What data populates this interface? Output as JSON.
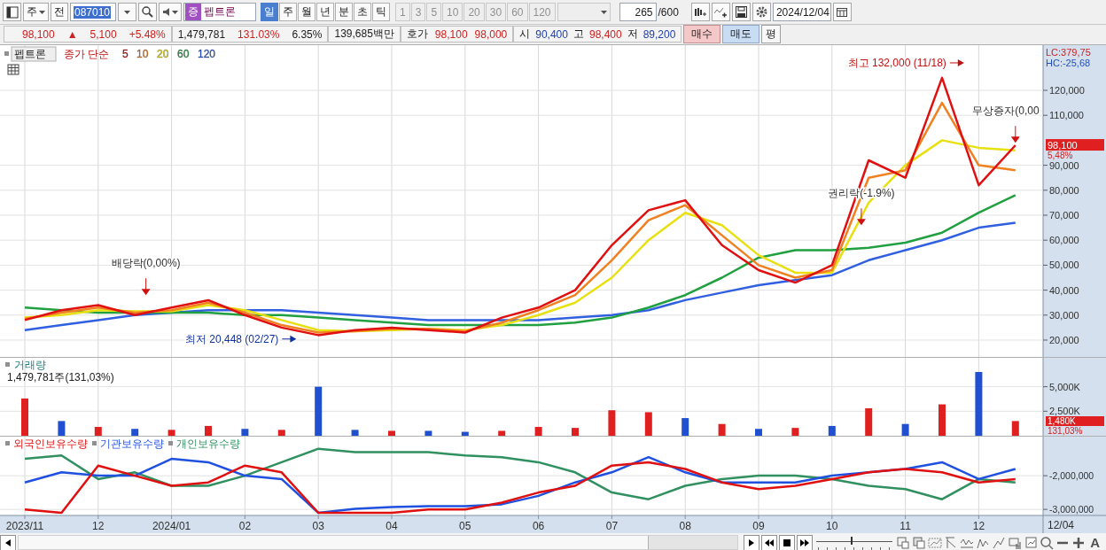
{
  "toolbar": {
    "market": "주",
    "prev": "전",
    "code": "087010",
    "badge": "증",
    "name": "펩트론",
    "periods": [
      {
        "label": "일",
        "selected": true
      },
      {
        "label": "주",
        "selected": false
      },
      {
        "label": "월",
        "selected": false
      },
      {
        "label": "년",
        "selected": false
      },
      {
        "label": "분",
        "selected": false
      },
      {
        "label": "초",
        "selected": false
      },
      {
        "label": "틱",
        "selected": false
      }
    ],
    "intervals": [
      "1",
      "3",
      "5",
      "10",
      "20",
      "30",
      "60",
      "120"
    ],
    "count": "265",
    "count_max": "/600",
    "date": "2024/12/04"
  },
  "quote": {
    "price": "98,100",
    "direction": "▲",
    "change": "5,100",
    "change_pct": "+5.48%",
    "volume": "1,479,781",
    "volume_ratio": "131.03%",
    "turnover": "6.35%",
    "amount": "139,685백만",
    "quote_label": "호가",
    "ask": "98,100",
    "bid": "98,000",
    "open_label": "시",
    "open": "90,400",
    "high_label": "고",
    "high": "98,400",
    "low_label": "저",
    "low": "89,200",
    "buy": "매수",
    "sell": "매도",
    "avg": "평"
  },
  "price_pane": {
    "name": "펩트론",
    "legend_label": "종가 단순",
    "lc": "LC:379,75",
    "hc": "HC:-25,68",
    "price_tag": "98,100",
    "pct_tag": "5,48%",
    "chart_data": {
      "type": "line",
      "grid": true,
      "ylim": [
        13262,
        138085
      ],
      "yticks": [
        {
          "value": 20000,
          "label": "20,000"
        },
        {
          "value": 30000,
          "label": "30,000"
        },
        {
          "value": 40000,
          "label": "40,000"
        },
        {
          "value": 50000,
          "label": "50,000"
        },
        {
          "value": 60000,
          "label": "60,000"
        },
        {
          "value": 70000,
          "label": "70,000"
        },
        {
          "value": 80000,
          "label": "80,000"
        },
        {
          "value": 90000,
          "label": "90,000"
        },
        {
          "value": 110000,
          "label": "110,000"
        },
        {
          "value": 120000,
          "label": "120,000"
        }
      ],
      "series": [
        {
          "name": "5",
          "color": "#e01010",
          "values": [
            28000,
            32000,
            34000,
            30000,
            33000,
            36000,
            30000,
            25000,
            22000,
            24000,
            25000,
            24000,
            23000,
            29000,
            33000,
            40000,
            58000,
            72000,
            76000,
            58000,
            48000,
            43000,
            50000,
            92000,
            85000,
            125000,
            82000,
            98000
          ]
        },
        {
          "name": "10",
          "color": "#f08020",
          "values": [
            28500,
            31000,
            33000,
            31000,
            32000,
            35000,
            31000,
            26000,
            23000,
            23500,
            24500,
            24500,
            23500,
            27000,
            32000,
            38000,
            52000,
            68000,
            74000,
            62000,
            50000,
            45000,
            48000,
            85000,
            88000,
            115000,
            90000,
            88000
          ]
        },
        {
          "name": "20",
          "color": "#e8e010",
          "values": [
            29000,
            30000,
            32000,
            31500,
            31500,
            34000,
            32000,
            28000,
            24000,
            23500,
            24000,
            24500,
            24000,
            26000,
            30000,
            35000,
            45000,
            60000,
            71000,
            66000,
            54000,
            47000,
            47000,
            75000,
            90000,
            100000,
            97000,
            96000
          ]
        },
        {
          "name": "60",
          "color": "#20a040",
          "values": [
            33000,
            32000,
            31000,
            31000,
            31000,
            31000,
            30000,
            30000,
            29000,
            28000,
            27000,
            26000,
            26000,
            26000,
            26000,
            27000,
            29000,
            33000,
            38000,
            45000,
            53000,
            56000,
            56000,
            57000,
            59000,
            63000,
            71000,
            78000
          ]
        },
        {
          "name": "120",
          "color": "#3060e0",
          "values": [
            24000,
            26000,
            28000,
            30000,
            31000,
            32000,
            32000,
            32000,
            31000,
            30000,
            29000,
            28000,
            28000,
            28000,
            28000,
            29000,
            30000,
            32000,
            36000,
            39000,
            42000,
            44000,
            46000,
            52000,
            56000,
            60000,
            65000,
            67000
          ]
        }
      ],
      "annotations": [
        "최고 132,000 (11/18)",
        "최저 20,448 (02/27)",
        "배당락(0,00%)",
        "권리락(-1.9%)",
        "무상증자(0,00"
      ]
    }
  },
  "volume_pane": {
    "title": "거래량",
    "reading": "1,479,781주(131,03%)",
    "tag": "1,480K",
    "pct_tag": "131,03%",
    "chart_data": {
      "type": "bar",
      "grid": true,
      "ylim": [
        0,
        7946
      ],
      "yticks": [
        {
          "value": 2500,
          "label": "2,500K"
        },
        {
          "value": 5000,
          "label": "5,000K"
        }
      ],
      "series": [
        {
          "color": "#e02020",
          "values": [
            3800,
            null,
            900,
            null,
            600,
            1000,
            null,
            600,
            null,
            null,
            500,
            null,
            null,
            500,
            900,
            800,
            2600,
            2400,
            null,
            1200,
            null,
            800,
            null,
            2800,
            null,
            3200,
            null,
            1500
          ]
        },
        {
          "color": "#2050d0",
          "values": [
            null,
            1500,
            null,
            700,
            null,
            null,
            700,
            null,
            5000,
            600,
            null,
            500,
            400,
            null,
            null,
            null,
            null,
            null,
            1800,
            null,
            700,
            null,
            1000,
            null,
            1200,
            null,
            6500,
            null
          ]
        }
      ]
    }
  },
  "holdings_pane": {
    "chart_data": {
      "type": "line",
      "grid": true,
      "categories": [
        "2023/11",
        null,
        "12",
        null,
        "2024/01",
        null,
        "02",
        null,
        "03",
        null,
        "04",
        null,
        "05",
        null,
        "06",
        null,
        "07",
        null,
        "08",
        null,
        "09",
        null,
        "10",
        null,
        "11",
        null,
        "12",
        null
      ],
      "ylim": [
        -3180000,
        -840000
      ],
      "yticks": [
        {
          "value": -2000000,
          "label": "-2,000,000"
        },
        {
          "value": -3000000,
          "label": "-3,000,000"
        }
      ],
      "series": [
        {
          "name": "외국인보유수량",
          "color": "#e01010",
          "values": [
            -3000000,
            -3100000,
            -1700000,
            -2000000,
            -2300000,
            -2200000,
            -1700000,
            -1900000,
            -3100000,
            -3100000,
            -3100000,
            -3000000,
            -3000000,
            -2800000,
            -2500000,
            -2300000,
            -1700000,
            -1600000,
            -1800000,
            -2200000,
            -2400000,
            -2300000,
            -2100000,
            -1900000,
            -1800000,
            -1900000,
            -2200000,
            -2100000
          ]
        },
        {
          "name": "기관보유수량",
          "color": "#2050e0",
          "values": [
            -2200000,
            -1900000,
            -2000000,
            -2000000,
            -1500000,
            -1600000,
            -2000000,
            -2100000,
            -3100000,
            -2980000,
            -2930000,
            -2900000,
            -2900000,
            -2850000,
            -2600000,
            -2200000,
            -1900000,
            -1450000,
            -1900000,
            -2200000,
            -2200000,
            -2200000,
            -2000000,
            -1900000,
            -1800000,
            -1600000,
            -2100000,
            -1800000
          ]
        },
        {
          "name": "개인보유수량",
          "color": "#309060",
          "values": [
            -1500000,
            -1400000,
            -2100000,
            -1900000,
            -2300000,
            -2300000,
            -2000000,
            -1600000,
            -1200000,
            -1300000,
            -1300000,
            -1300000,
            -1400000,
            -1450000,
            -1600000,
            -1900000,
            -2500000,
            -2700000,
            -2300000,
            -2100000,
            -2000000,
            -2000000,
            -2100000,
            -2300000,
            -2400000,
            -2700000,
            -2100000,
            -2200000
          ]
        }
      ]
    }
  },
  "axis_date": "12/04",
  "bottom_toolbar": {
    "speed": {
      "level": 0.45
    },
    "font_button": "A"
  }
}
